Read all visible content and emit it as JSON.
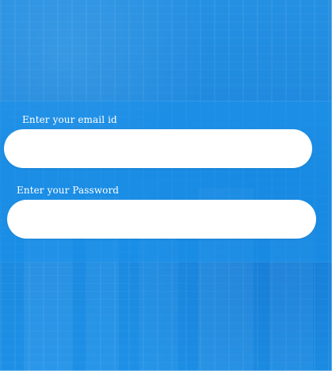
{
  "form": {
    "email_label": "Enter your email id",
    "password_label": "Enter your Password",
    "email_value": "",
    "password_value": ""
  },
  "colors": {
    "background": "#1f8fe6",
    "field_background": "#ffffff",
    "label_text": "#ffffff"
  }
}
